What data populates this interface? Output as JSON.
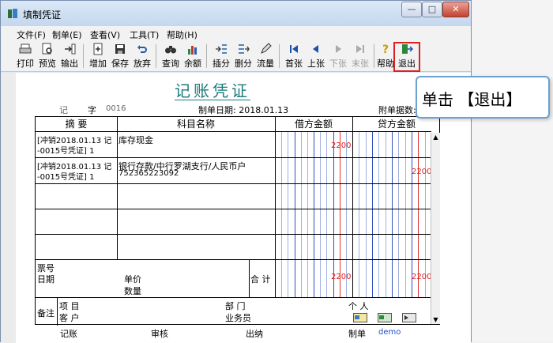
{
  "window": {
    "title": "填制凭证",
    "min_glyph": "—",
    "max_glyph": "□",
    "close_glyph": "✕"
  },
  "menu": [
    "文件(F)",
    "制单(E)",
    "查看(V)",
    "工具(T)",
    "帮助(H)"
  ],
  "toolbar": {
    "print": "打印",
    "preview": "预览",
    "export": "输出",
    "add": "增加",
    "save": "保存",
    "discard": "放弃",
    "query": "查询",
    "balance": "余额",
    "insert": "插分",
    "delete": "删分",
    "flow": "流量",
    "first": "首张",
    "prev": "上张",
    "next": "下张",
    "last": "末张",
    "help": "帮助",
    "exit": "退出"
  },
  "voucher": {
    "title": "记账凭证",
    "type_label": "记",
    "no_label": "字",
    "no_value": "0016",
    "date": "制单日期: 2018.01.13",
    "attach": "附单据数:",
    "headers": {
      "summary": "摘  要",
      "subject": "科目名称",
      "debit": "借方金额",
      "credit": "贷方金额"
    },
    "rows": [
      {
        "summary1": "[冲销2018.01.13 记",
        "summary2": "-0015号凭证] 1",
        "subject1": "库存现金",
        "subject2": "",
        "debit": "2200",
        "credit": ""
      },
      {
        "summary1": "[冲销2018.01.13 记",
        "summary2": "-0015号凭证] 1",
        "subject1": "银行存款/中行罗湖支行/人民币户",
        "subject2": "752365223092",
        "debit": "",
        "credit": "2200"
      }
    ],
    "ticket_no": "票号",
    "ticket_date": "日期",
    "unit_price": "单价",
    "quantity": "数量",
    "total_label": "合 计",
    "total_debit": "2200",
    "total_credit": "2200",
    "remark": "备注",
    "project": "项  目",
    "customer": "客  户",
    "dept": "部  门",
    "person": "个  人",
    "salesman": "业务员"
  },
  "footer": {
    "bookkeeper": "记账",
    "auditor": "审核",
    "cashier": "出纳",
    "maker": "制单",
    "maker_name": "demo"
  },
  "callout": "单击 【退出】",
  "colors": {
    "accent": "#1a7a7a",
    "amount_red": "#e02020",
    "highlight": "#e02020"
  }
}
